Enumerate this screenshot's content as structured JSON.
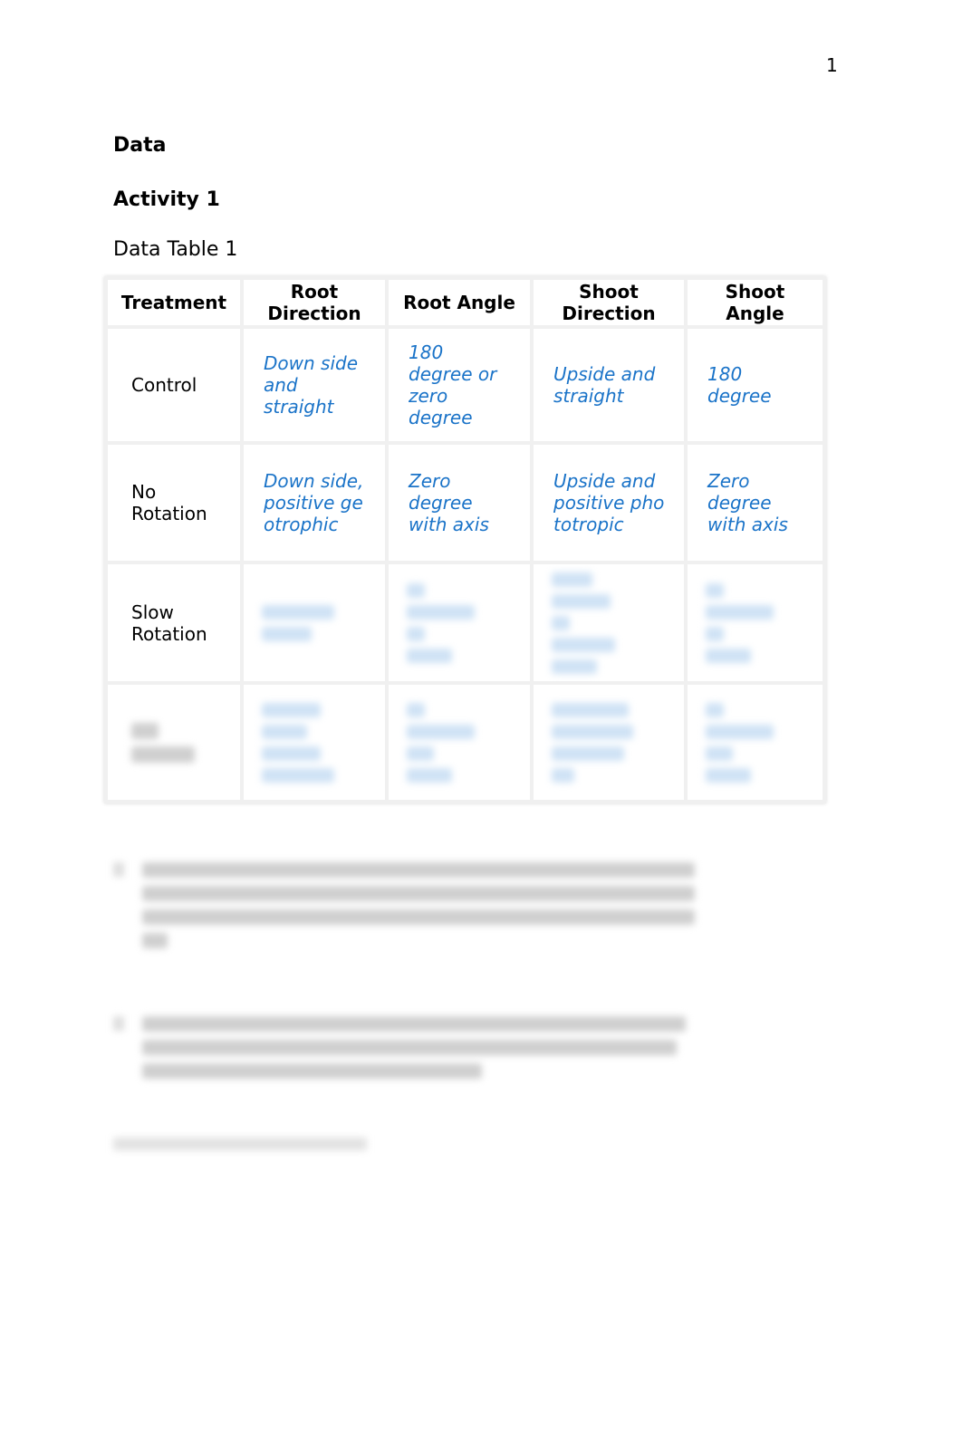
{
  "page_number": "1",
  "headings": {
    "section": "Data",
    "activity": "Activity 1"
  },
  "table": {
    "caption": "Data Table 1",
    "headers": [
      "Treatment",
      "Root Direction",
      "Root Angle",
      "Shoot Direction",
      "Shoot Angle"
    ],
    "rows": [
      {
        "treatment": "Control",
        "values": [
          "Down side and straight",
          "180 degree or zero degree",
          "Upside and straight",
          "180 degree"
        ]
      },
      {
        "treatment": "No Rotation",
        "values": [
          "Down side, positive geotrophic",
          "Zero degree with axis",
          "Upside and positive phototropic",
          "Zero degree with axis"
        ]
      },
      {
        "treatment": "Slow Rotation",
        "values": []
      }
    ]
  },
  "colors": {
    "answer_text": "#1a73c8",
    "table_border": "#f0f0f0"
  }
}
